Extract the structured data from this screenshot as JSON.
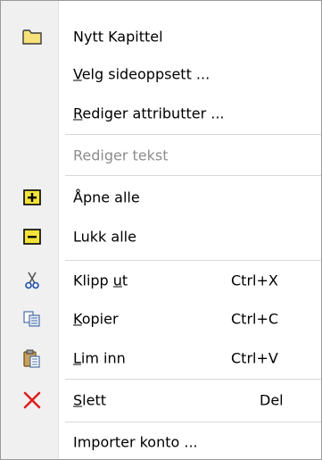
{
  "menu": {
    "items": [
      {
        "label": "Nytt Kapittel",
        "icon": "folder-icon",
        "enabled": true
      },
      {
        "label": "Velg sideoppsett ...",
        "mnemonic": "V",
        "enabled": true
      },
      {
        "label": "Rediger attributter ...",
        "mnemonic": "R",
        "enabled": true
      },
      {
        "label": "Rediger tekst",
        "enabled": false
      },
      {
        "label": "Åpne alle",
        "icon": "expand-plus-icon",
        "enabled": true
      },
      {
        "label": "Lukk alle",
        "icon": "collapse-minus-icon",
        "enabled": true
      },
      {
        "label": "Klipp ut",
        "icon": "scissors-icon",
        "shortcut": "Ctrl+X",
        "enabled": true
      },
      {
        "label": "Kopier",
        "icon": "copy-icon",
        "shortcut": "Ctrl+C",
        "enabled": true
      },
      {
        "label": "Lim inn",
        "icon": "paste-icon",
        "shortcut": "Ctrl+V",
        "enabled": true
      },
      {
        "label": "Slett",
        "icon": "delete-x-icon",
        "shortcut": "Del",
        "enabled": true
      },
      {
        "label": "Importer konto ...",
        "enabled": true
      }
    ]
  },
  "colors": {
    "folder": "#f5e27a",
    "expand_box": "#f3e33a",
    "delete_red": "#e02020",
    "disabled_text": "#8c8c8c"
  }
}
